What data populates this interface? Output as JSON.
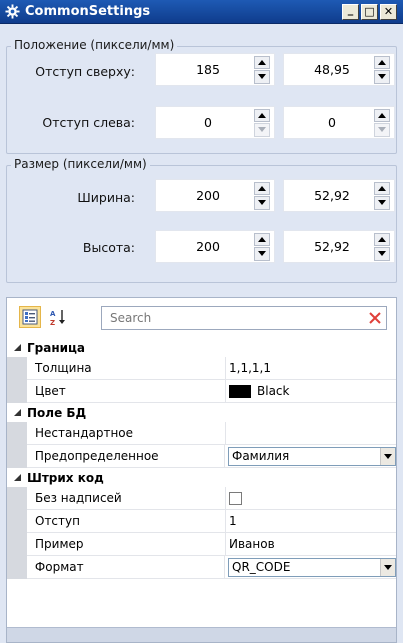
{
  "window": {
    "title": "CommonSettings",
    "buttons": {
      "minimize": "_",
      "maximize": "□",
      "close": "✕"
    }
  },
  "position_group": {
    "title": "Положение (пиксели/мм)",
    "top": {
      "label": "Отступ сверху:",
      "pixels": "185",
      "mm": "48,95"
    },
    "left": {
      "label": "Отступ слева:",
      "pixels": "0",
      "mm": "0"
    }
  },
  "size_group": {
    "title": "Размер (пиксели/мм)",
    "width": {
      "label": "Ширина:",
      "pixels": "200",
      "mm": "52,92"
    },
    "height": {
      "label": "Высота:",
      "pixels": "200",
      "mm": "52,92"
    }
  },
  "property_grid": {
    "search_placeholder": "Search",
    "categories": [
      {
        "name": "Граница",
        "properties": [
          {
            "name": "Толщина",
            "value": "1,1,1,1",
            "kind": "text"
          },
          {
            "name": "Цвет",
            "value": "Black",
            "kind": "color",
            "color": "#000000"
          }
        ]
      },
      {
        "name": "Поле БД",
        "properties": [
          {
            "name": "Нестандартное",
            "value": "",
            "kind": "text"
          },
          {
            "name": "Предопределенное",
            "value": "Фамилия",
            "kind": "combo"
          }
        ]
      },
      {
        "name": "Штрих код",
        "properties": [
          {
            "name": "Без надписей",
            "value": "",
            "kind": "checkbox"
          },
          {
            "name": "Отступ",
            "value": "1",
            "kind": "text"
          },
          {
            "name": "Пример",
            "value": "Иванов",
            "kind": "text"
          },
          {
            "name": "Формат",
            "value": "QR_CODE",
            "kind": "combo"
          }
        ]
      }
    ]
  },
  "colors": {
    "titlebar": "#1e5ab4",
    "panel_bg": "#dfe6f3",
    "search_clear": "#e0403a",
    "categorized_active": "#fbe39a"
  }
}
